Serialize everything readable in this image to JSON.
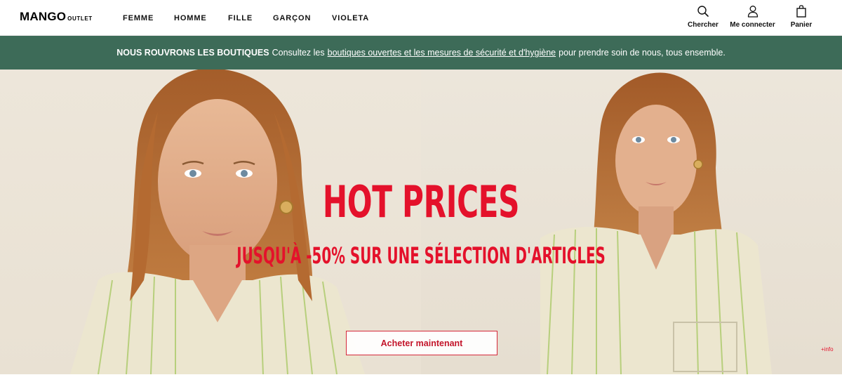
{
  "brand": {
    "main": "MANGO",
    "sub": "OUTLET"
  },
  "nav": {
    "items": [
      {
        "label": "FEMME"
      },
      {
        "label": "HOMME"
      },
      {
        "label": "FILLE"
      },
      {
        "label": "GARÇON"
      },
      {
        "label": "VIOLETA"
      }
    ]
  },
  "tools": {
    "search": {
      "label": "Chercher",
      "icon": "search-icon"
    },
    "account": {
      "label": "Me connecter",
      "icon": "user-icon"
    },
    "cart": {
      "label": "Panier",
      "icon": "shopping-bag-icon"
    }
  },
  "notice": {
    "bold": "NOUS ROUVRONS LES BOUTIQUES",
    "text_before": "Consultez les",
    "link": "boutiques ouvertes et les mesures de sécurité et d'hygiène",
    "text_after": "pour prendre soin de nous, tous ensemble.",
    "background": "#3d6b58"
  },
  "hero": {
    "title": "HOT PRICES",
    "subtitle": "JUSQU'À -50% SUR UNE SÉLECTION D'ARTICLES",
    "cta": "Acheter maintenant",
    "info": "+info",
    "accent_color": "#e4112b"
  }
}
